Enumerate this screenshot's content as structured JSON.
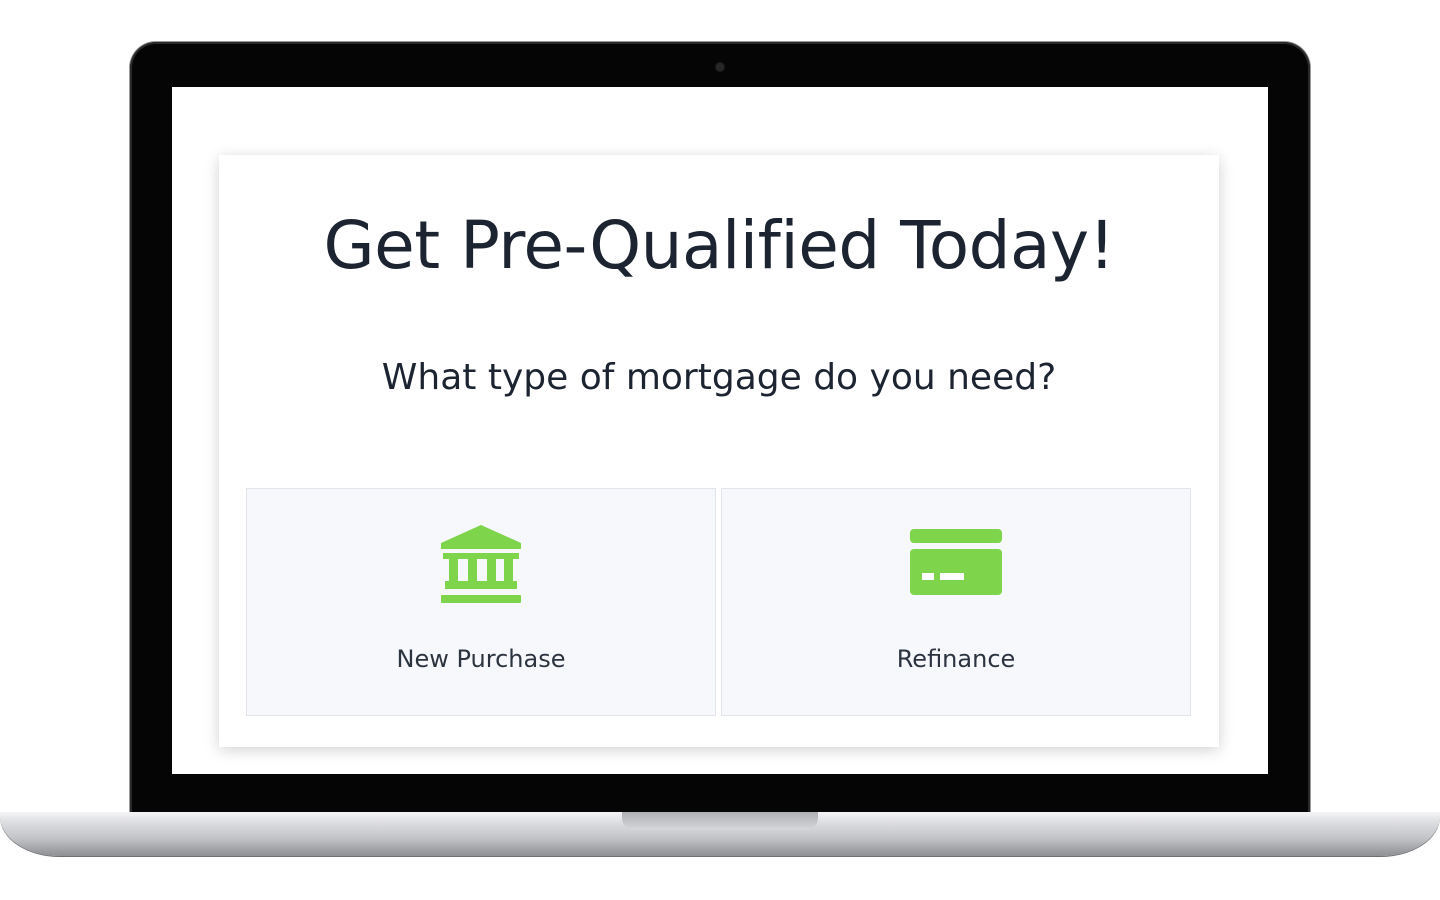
{
  "page": {
    "title": "Get Pre-Qualified Today!",
    "question": "What type of mortgage do you need?"
  },
  "options": [
    {
      "label": "New Purchase",
      "icon": "bank-icon"
    },
    {
      "label": "Refinance",
      "icon": "credit-card-icon"
    }
  ],
  "colors": {
    "accent": "#7ed44a",
    "text": "#1b2430",
    "tile_bg": "#f7f8fc"
  }
}
